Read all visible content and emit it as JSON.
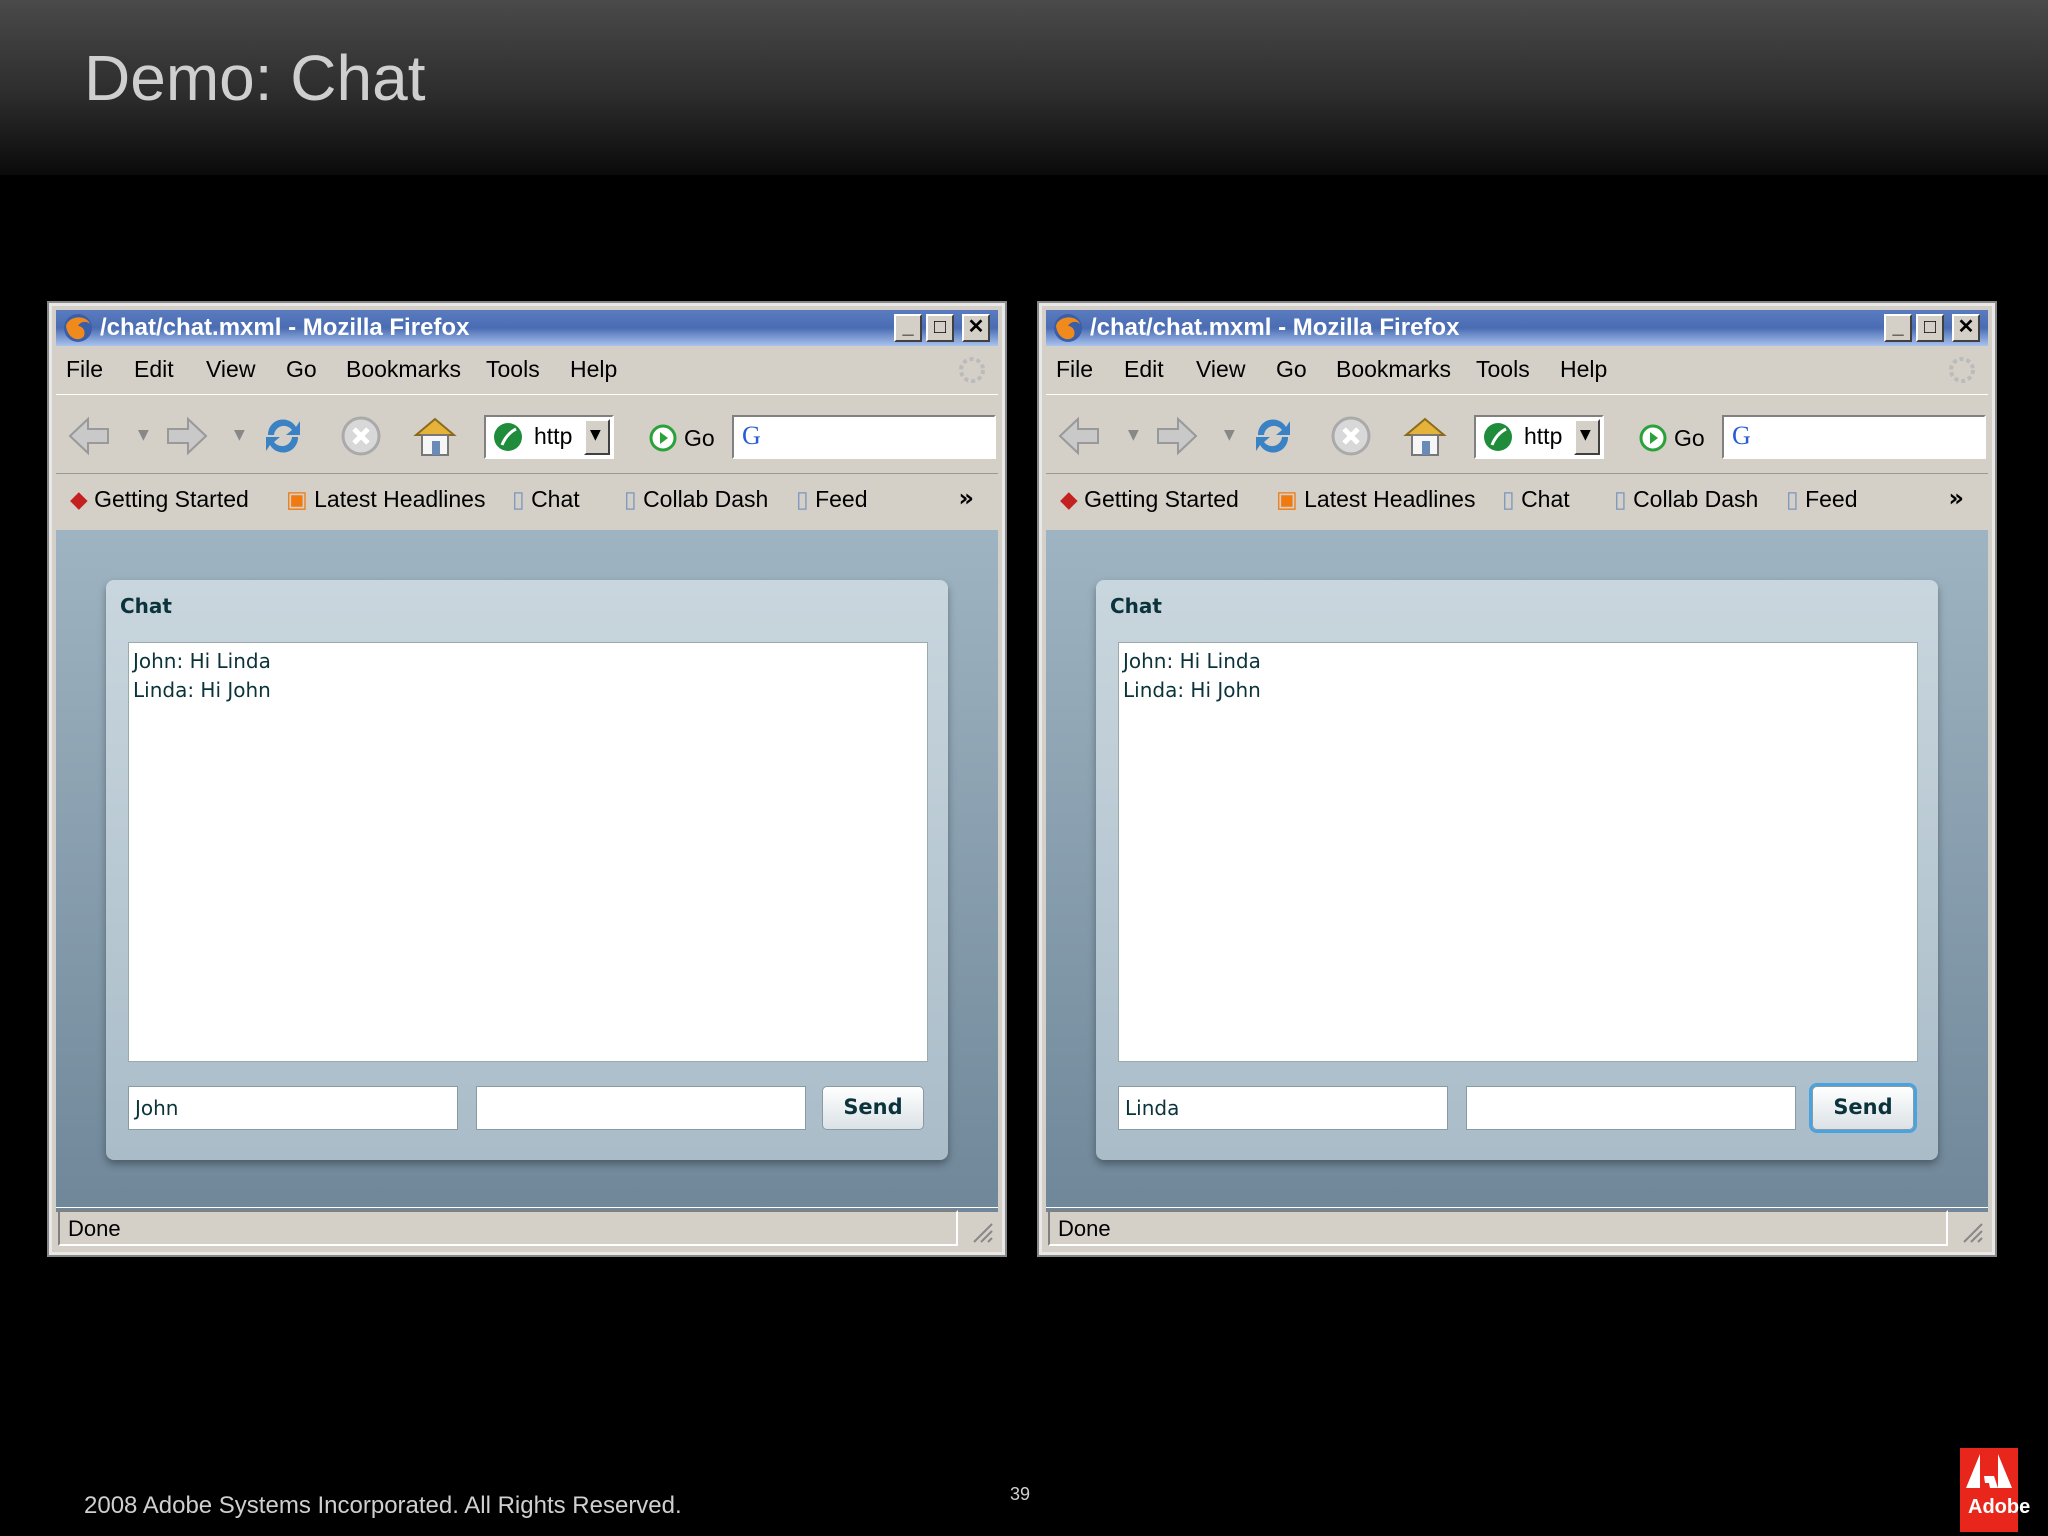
{
  "slide": {
    "title": "Demo: Chat",
    "copyright": "2008 Adobe Systems Incorporated.  All Rights Reserved.",
    "page_number": "39",
    "logo_text": "Adobe",
    "accent_color": "#e8261b"
  },
  "browser": {
    "window_title": "/chat/chat.mxml - Mozilla Firefox",
    "menu": [
      "File",
      "Edit",
      "View",
      "Go",
      "Bookmarks",
      "Tools",
      "Help"
    ],
    "url_text": "http",
    "go_label": "Go",
    "bookmarks": [
      {
        "label": "Getting Started",
        "icon": "firefox-icon"
      },
      {
        "label": "Latest Headlines",
        "icon": "rss-icon"
      },
      {
        "label": "Chat",
        "icon": "page-icon"
      },
      {
        "label": "Collab Dash",
        "icon": "page-icon"
      },
      {
        "label": "Feed",
        "icon": "page-icon"
      }
    ],
    "overflow": "»",
    "status": "Done"
  },
  "windows": [
    {
      "panel_title": "Chat",
      "messages": [
        "John: Hi Linda",
        "Linda: Hi John"
      ],
      "name_value": "John",
      "message_value": "",
      "send_label": "Send"
    },
    {
      "panel_title": "Chat",
      "messages": [
        "John: Hi Linda",
        "Linda: Hi John"
      ],
      "name_value": "Linda",
      "message_value": "",
      "send_label": "Send"
    }
  ]
}
